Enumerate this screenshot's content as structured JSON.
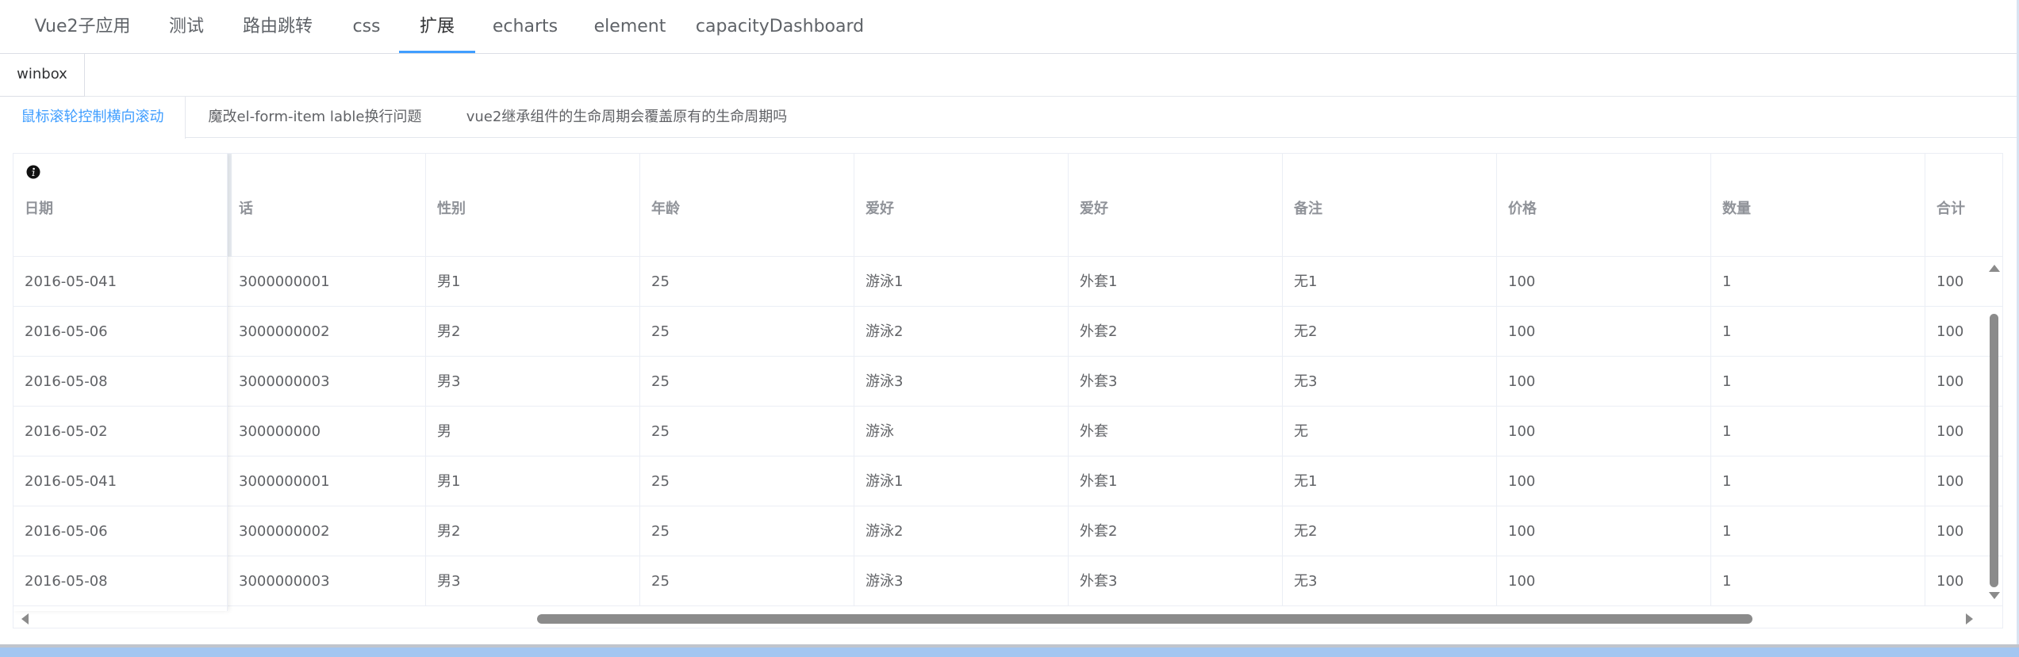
{
  "top_tabs": [
    {
      "label": "Vue2子应用"
    },
    {
      "label": "测试"
    },
    {
      "label": "路由跳转"
    },
    {
      "label": "css"
    },
    {
      "label": "扩展"
    },
    {
      "label": "echarts"
    },
    {
      "label": "element"
    },
    {
      "label": "capacityDashboard"
    }
  ],
  "active_top_tab": "扩展",
  "chip": {
    "label": "winbox"
  },
  "sub_tabs": [
    {
      "label": "鼠标滚轮控制横向滚动"
    },
    {
      "label": "魔改el-form-item lable换行问题"
    },
    {
      "label": "vue2继承组件的生命周期会覆盖原有的生命周期吗"
    }
  ],
  "active_sub_tab": "鼠标滚轮控制横向滚动",
  "table": {
    "fixed_header": "日期",
    "headers": [
      "话",
      "性别",
      "年龄",
      "爱好",
      "爱好",
      "备注",
      "价格",
      "数量",
      "合计"
    ],
    "rows": [
      {
        "date": "2016-05-041",
        "cells": [
          "3000000001",
          "男1",
          "25",
          "游泳1",
          "外套1",
          "无1",
          "100",
          "1",
          "100"
        ]
      },
      {
        "date": "2016-05-06",
        "cells": [
          "3000000002",
          "男2",
          "25",
          "游泳2",
          "外套2",
          "无2",
          "100",
          "1",
          "100"
        ]
      },
      {
        "date": "2016-05-08",
        "cells": [
          "3000000003",
          "男3",
          "25",
          "游泳3",
          "外套3",
          "无3",
          "100",
          "1",
          "100"
        ]
      },
      {
        "date": "2016-05-02",
        "cells": [
          "300000000",
          "男",
          "25",
          "游泳",
          "外套",
          "无",
          "100",
          "1",
          "100"
        ]
      },
      {
        "date": "2016-05-041",
        "cells": [
          "3000000001",
          "男1",
          "25",
          "游泳1",
          "外套1",
          "无1",
          "100",
          "1",
          "100"
        ]
      },
      {
        "date": "2016-05-06",
        "cells": [
          "3000000002",
          "男2",
          "25",
          "游泳2",
          "外套2",
          "无2",
          "100",
          "1",
          "100"
        ]
      },
      {
        "date": "2016-05-08",
        "cells": [
          "3000000003",
          "男3",
          "25",
          "游泳3",
          "外套3",
          "无3",
          "100",
          "1",
          "100"
        ]
      }
    ]
  },
  "colors": {
    "accent": "#409eff",
    "header_text": "#909399",
    "cell_text": "#606266",
    "border": "#ebeef5",
    "scrollbar": "#8b8b8b",
    "bottom_bar": "#a3c6f1"
  },
  "icons": {
    "info": "info-circle-icon"
  }
}
